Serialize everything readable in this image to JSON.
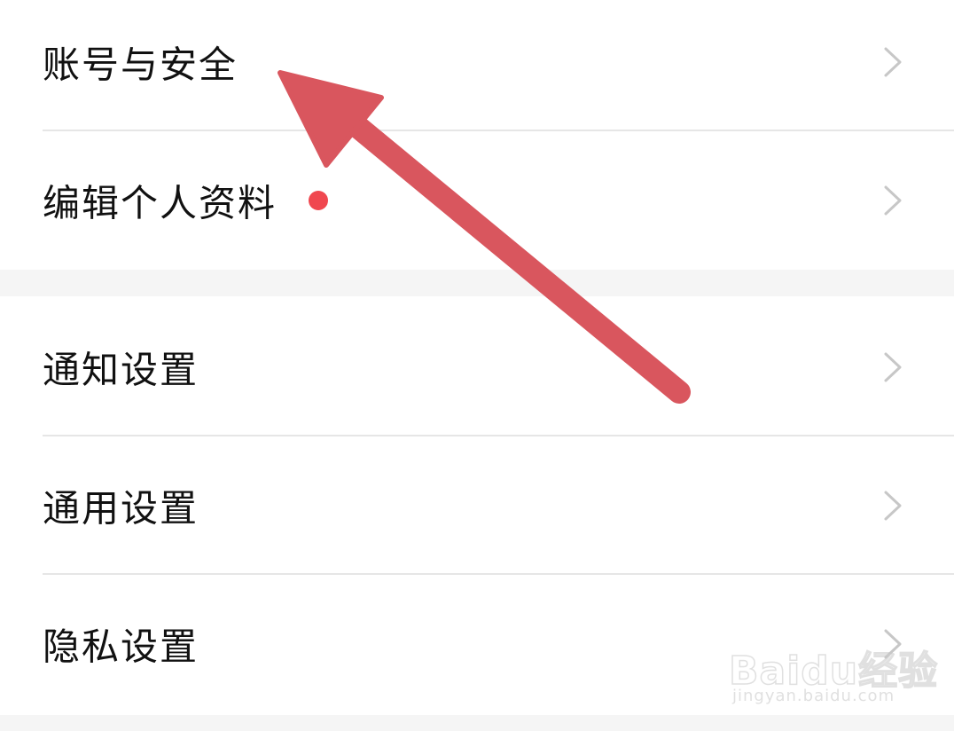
{
  "settings": {
    "items": [
      {
        "label": "账号与安全",
        "has_red_dot": false
      },
      {
        "label": "编辑个人资料",
        "has_red_dot": true
      },
      {
        "label": "通知设置",
        "has_red_dot": false
      },
      {
        "label": "通用设置",
        "has_red_dot": false
      },
      {
        "label": "隐私设置",
        "has_red_dot": false
      }
    ]
  },
  "colors": {
    "text": "#111111",
    "chevron": "#c7c7c7",
    "divider": "#e6e6e6",
    "group_gap": "#f5f5f5",
    "red_dot": "#f0474f",
    "annotation_arrow": "#d9565e"
  },
  "annotation": {
    "type": "arrow",
    "points_to": "账号与安全"
  },
  "watermark": {
    "logo_text": "Baidu经验",
    "url": "jingyan.baidu.com"
  }
}
